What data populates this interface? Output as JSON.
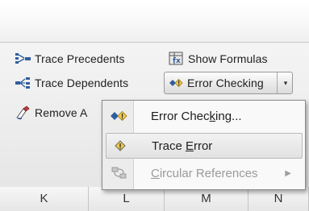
{
  "ribbon": {
    "trace_precedents": "Trace Precedents",
    "show_formulas": "Show Formulas",
    "trace_dependents": "Trace Dependents",
    "error_checking": "Error Checking",
    "remove_arrows_partial": "Remove A",
    "dropdown_glyph": "▾"
  },
  "menu": {
    "items": [
      {
        "pre": "Error Chec",
        "u": "k",
        "post": "ing...",
        "icon": "error-checking-icon",
        "state": "normal"
      },
      {
        "pre": "Trace ",
        "u": "E",
        "post": "rror",
        "icon": "trace-error-icon",
        "state": "hover"
      },
      {
        "pre": "",
        "u": "C",
        "post": "ircular References",
        "icon": "circular-references-icon",
        "state": "disabled"
      }
    ],
    "submenu_glyph": "▶"
  },
  "columns": [
    "K",
    "L",
    "M",
    "N"
  ],
  "colors": {
    "accent_blue": "#2f5e9e",
    "warning_yellow": "#f0c94a"
  }
}
